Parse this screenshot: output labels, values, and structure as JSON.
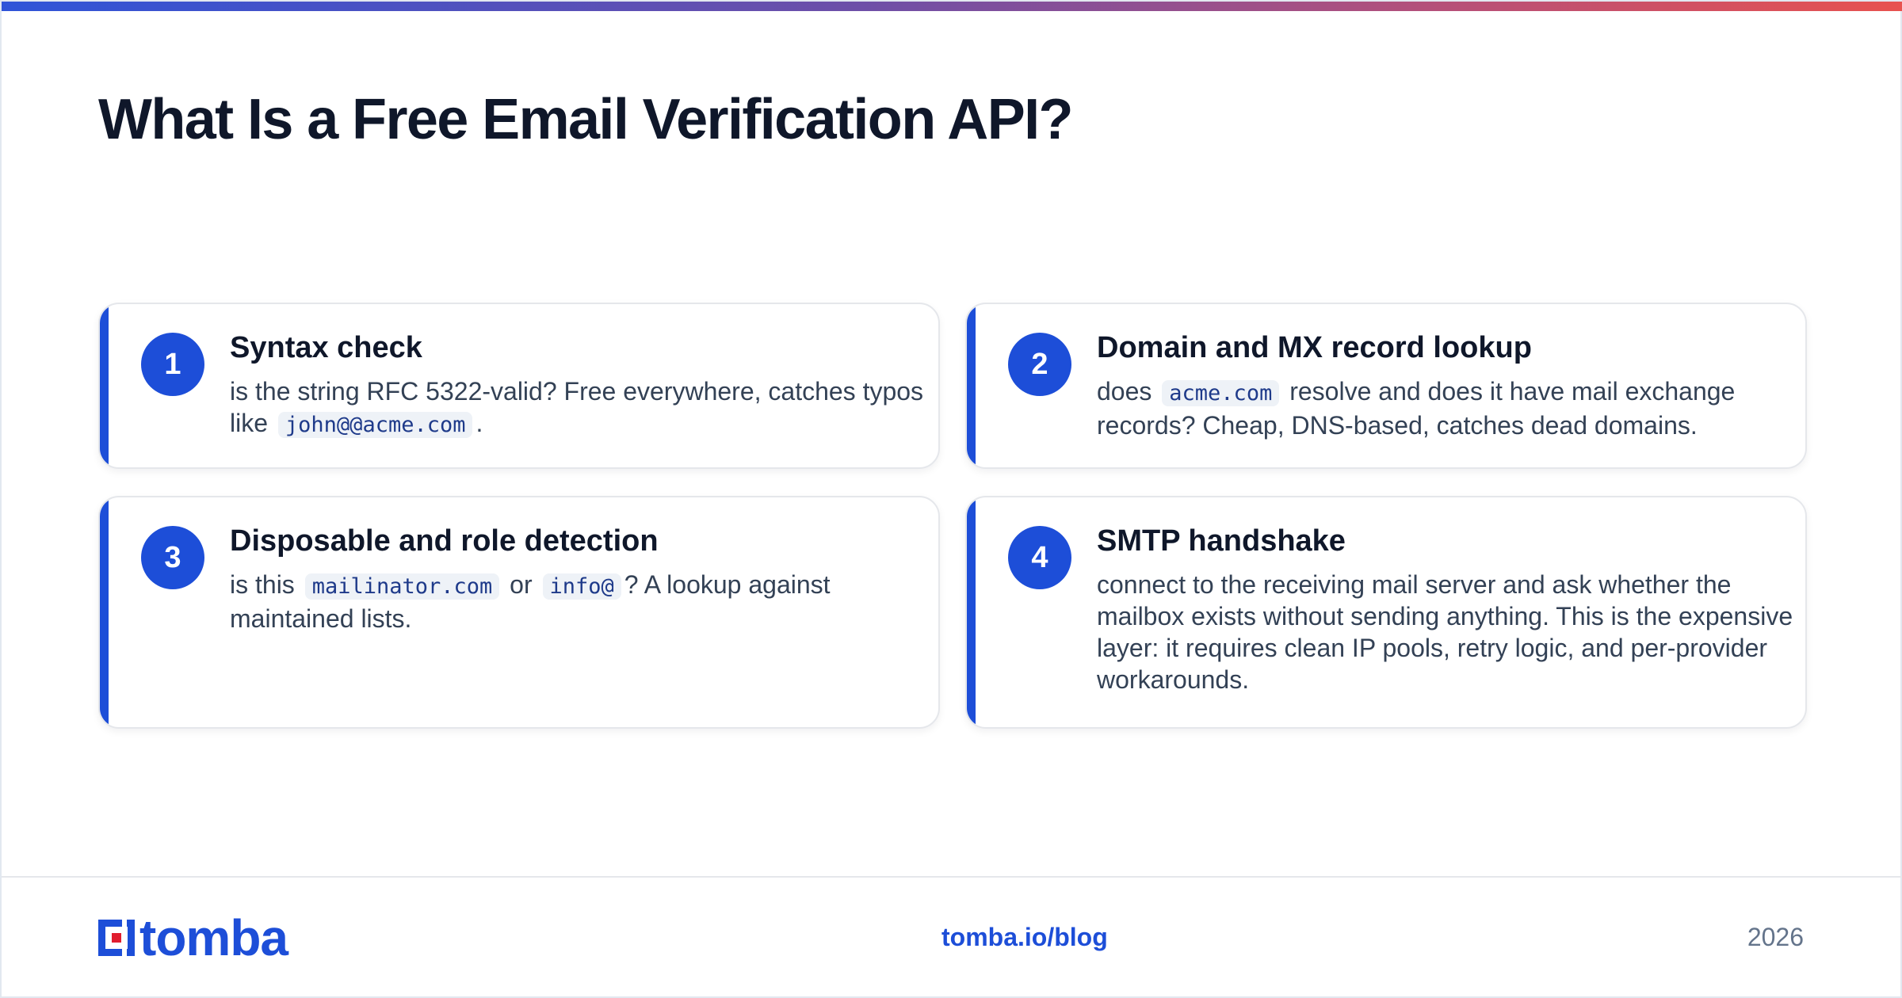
{
  "header": {
    "title": "What Is a Free Email Verification API?"
  },
  "cards": [
    {
      "number": "1",
      "title": "Syntax check",
      "body": {
        "t1": "is the string RFC 5322-valid? Free everywhere, catches typos like",
        "c1": "john@@acme.com",
        "t2": "."
      }
    },
    {
      "number": "2",
      "title": "Domain and MX record lookup",
      "body": {
        "t1": "does",
        "c1": "acme.com",
        "t2": "resolve and does it have mail exchange records? Cheap, DNS-based, catches dead domains."
      }
    },
    {
      "number": "3",
      "title": "Disposable and role detection",
      "body": {
        "t1": "is this",
        "c1": "mailinator.com",
        "t2": "or",
        "c2": "info@",
        "t3": "? A lookup against maintained lists."
      }
    },
    {
      "number": "4",
      "title": "SMTP handshake",
      "body": {
        "t1": "connect to the receiving mail server and ask whether the mailbox exists without sending anything. This is the expensive layer: it requires clean IP pools, retry logic, and per-provider workarounds."
      }
    }
  ],
  "footer": {
    "logo_text": "tomba",
    "url": "tomba.io/blog",
    "year": "2026"
  },
  "colors": {
    "accent": "#1d4ed8",
    "logo_red": "#e11d2e",
    "title": "#0f172a",
    "body_text": "#334155"
  }
}
